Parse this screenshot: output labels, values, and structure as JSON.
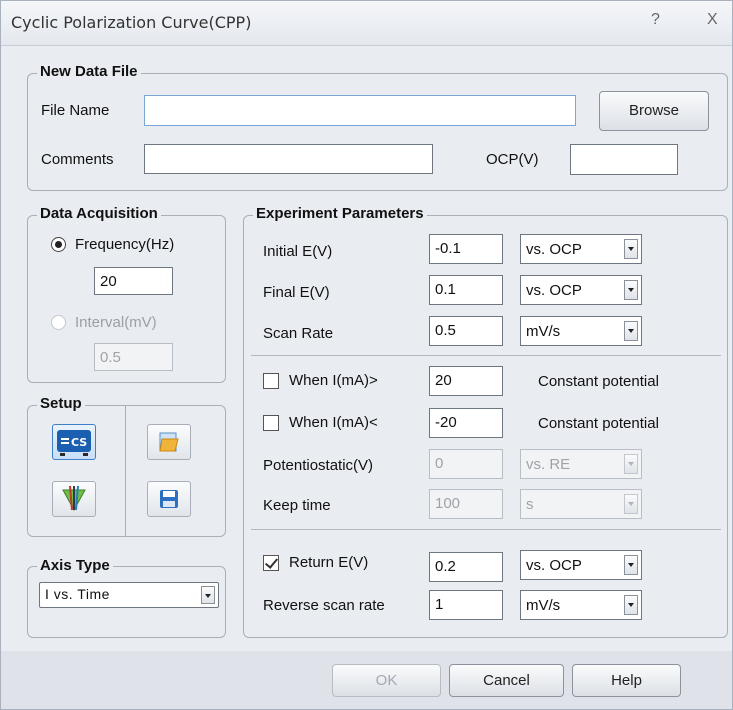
{
  "window": {
    "title": "Cyclic Polarization Curve(CPP)",
    "help": "?",
    "close": "X"
  },
  "new_data_file": {
    "legend": "New Data File",
    "file_name_label": "File Name",
    "file_name_value": "",
    "browse_label": "Browse",
    "comments_label": "Comments",
    "comments_value": "",
    "ocp_label": "OCP(V)",
    "ocp_value": ""
  },
  "data_acquisition": {
    "legend": "Data Acquisition",
    "frequency_label": "Frequency(Hz)",
    "frequency_value": "20",
    "interval_label": "Interval(mV)",
    "interval_value": "0.5"
  },
  "setup": {
    "legend": "Setup",
    "icons": [
      "cs-device-icon",
      "open-file-icon",
      "electrode-icon",
      "save-icon"
    ],
    "cs_text": "CS"
  },
  "axis_type": {
    "legend": "Axis Type",
    "value": "I vs. Time"
  },
  "experiment": {
    "legend": "Experiment Parameters",
    "initial_label": "Initial E(V)",
    "initial_value": "-0.1",
    "initial_ref": "vs. OCP",
    "final_label": "Final E(V)",
    "final_value": "0.1",
    "final_ref": "vs. OCP",
    "scan_label": "Scan Rate",
    "scan_value": "0.5",
    "scan_unit": "mV/s",
    "when_gt_label": "When I(mA)>",
    "when_gt_value": "20",
    "when_gt_action": "Constant potential",
    "when_lt_label": "When I(mA)<",
    "when_lt_value": "-20",
    "when_lt_action": "Constant potential",
    "potentiostatic_label": "Potentiostatic(V)",
    "potentiostatic_value": "0",
    "potentiostatic_ref": "vs. RE",
    "keep_label": "Keep time",
    "keep_value": "100",
    "keep_unit": "s",
    "return_label": "Return E(V)",
    "return_value": "0.2",
    "return_ref": "vs. OCP",
    "reverse_label": "Reverse scan rate",
    "reverse_value": "1",
    "reverse_unit": "mV/s"
  },
  "footer": {
    "ok": "OK",
    "cancel": "Cancel",
    "help": "Help"
  }
}
